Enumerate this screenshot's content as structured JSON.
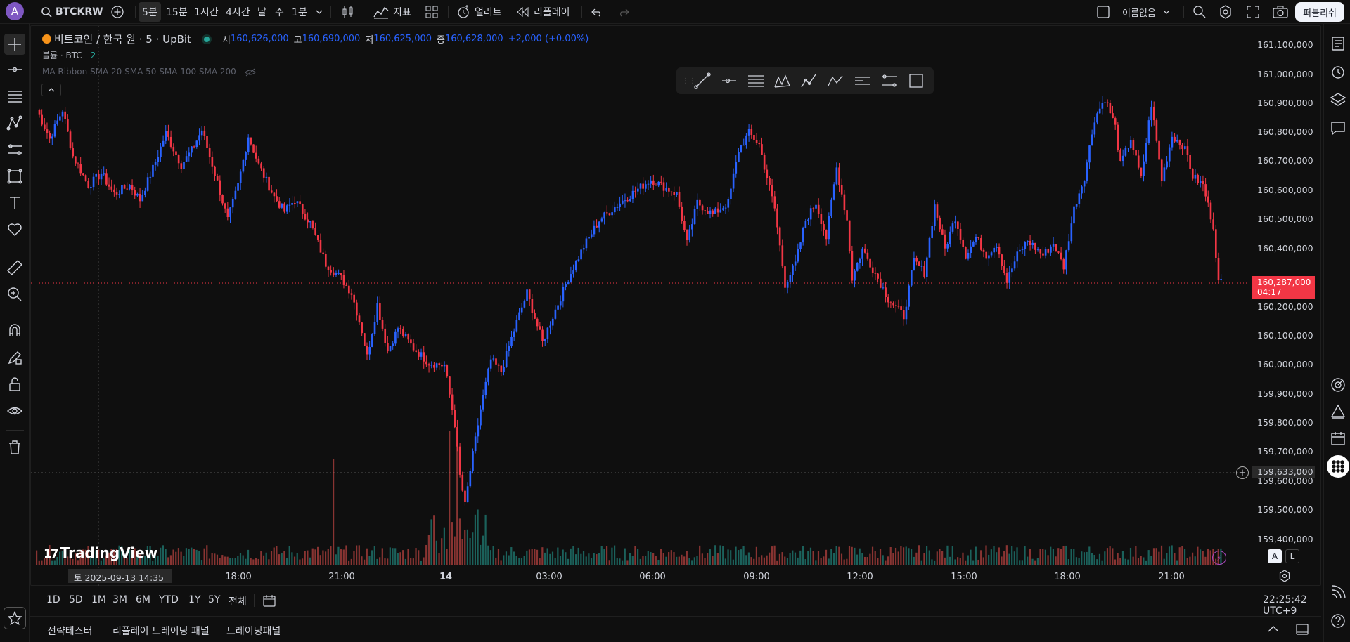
{
  "topbar": {
    "avatar_letter": "A",
    "symbol": "BTCKRW",
    "intervals": [
      "5분",
      "15분",
      "1시간",
      "4시간",
      "날",
      "주",
      "1분"
    ],
    "indicators_label": "지표",
    "alert_label": "얼러트",
    "replay_label": "리플레이",
    "layout_name": "이름없음",
    "publish_label": "퍼블리쉬"
  },
  "legend": {
    "title": "비트코인 / 한국 원 · 5 · UpBit",
    "open_label": "시",
    "open": "160,626,000",
    "high_label": "고",
    "high": "160,690,000",
    "low_label": "저",
    "low": "160,625,000",
    "close_label": "종",
    "close": "160,628,000",
    "change": "+2,000 (+0.00%)",
    "volume_label": "볼륨 · BTC",
    "volume_value": "2",
    "ma_ribbon": "MA Ribbon SMA 20 SMA 50 SMA 100 SMA 200"
  },
  "price_axis": {
    "labels": [
      "161,100,000",
      "161,000,000",
      "160,900,000",
      "160,800,000",
      "160,700,000",
      "160,600,000",
      "160,500,000",
      "160,400,000",
      "160,200,000",
      "160,100,000",
      "160,000,000",
      "159,900,000",
      "159,800,000",
      "159,700,000",
      "159,600,000",
      "159,500,000",
      "159,400,000"
    ],
    "current_price": "160,287,000",
    "countdown": "04:17",
    "crosshair_price": "159,633,000"
  },
  "time_axis": {
    "labels": [
      "18:00",
      "21:00",
      "14",
      "03:00",
      "06:00",
      "09:00",
      "12:00",
      "15:00",
      "18:00",
      "21:00"
    ],
    "crosshair_time": "토 2025-09-13   14:35"
  },
  "watermark": "TradingView",
  "scale_buttons": {
    "auto": "A",
    "log": "L"
  },
  "range_bar": {
    "ranges": [
      "1D",
      "5D",
      "1M",
      "3M",
      "6M",
      "YTD",
      "1Y",
      "5Y",
      "전체"
    ],
    "clock": "22:25:42 UTC+9"
  },
  "bottom_tabs": [
    "전략테스터",
    "리플레이 트레이딩 패널",
    "트레이딩패널"
  ],
  "colors": {
    "up": "#2962ff",
    "down": "#f23645",
    "vol_up": "#26a69a",
    "vol_down": "#ef5350",
    "bg": "#0f0f0f"
  },
  "chart_data": {
    "type": "candlestick",
    "symbol": "BTCKRW",
    "interval": "5",
    "ylim": [
      159350000,
      161150000
    ],
    "close_path": [
      [
        0,
        160880000
      ],
      [
        5,
        160780000
      ],
      [
        10,
        160880000
      ],
      [
        14,
        160720000
      ],
      [
        20,
        160620000
      ],
      [
        25,
        160660000
      ],
      [
        30,
        160590000
      ],
      [
        36,
        160620000
      ],
      [
        40,
        160570000
      ],
      [
        46,
        160700000
      ],
      [
        50,
        160800000
      ],
      [
        56,
        160690000
      ],
      [
        60,
        160740000
      ],
      [
        64,
        160810000
      ],
      [
        70,
        160630000
      ],
      [
        74,
        160500000
      ],
      [
        78,
        160620000
      ],
      [
        82,
        160790000
      ],
      [
        86,
        160690000
      ],
      [
        92,
        160580000
      ],
      [
        96,
        160530000
      ],
      [
        100,
        160570000
      ],
      [
        106,
        160490000
      ],
      [
        112,
        160350000
      ],
      [
        118,
        160300000
      ],
      [
        122,
        160250000
      ],
      [
        126,
        160120000
      ],
      [
        128,
        160030000
      ],
      [
        132,
        160210000
      ],
      [
        136,
        160050000
      ],
      [
        140,
        160130000
      ],
      [
        146,
        160060000
      ],
      [
        152,
        160010000
      ],
      [
        158,
        160000000
      ],
      [
        162,
        159800000
      ],
      [
        164,
        159620000
      ],
      [
        166,
        159520000
      ],
      [
        168,
        159640000
      ],
      [
        172,
        159850000
      ],
      [
        176,
        160020000
      ],
      [
        180,
        159980000
      ],
      [
        186,
        160150000
      ],
      [
        190,
        160250000
      ],
      [
        196,
        160080000
      ],
      [
        200,
        160170000
      ],
      [
        206,
        160300000
      ],
      [
        212,
        160410000
      ],
      [
        218,
        160500000
      ],
      [
        226,
        160560000
      ],
      [
        232,
        160600000
      ],
      [
        238,
        160640000
      ],
      [
        244,
        160610000
      ],
      [
        248,
        160590000
      ],
      [
        252,
        160420000
      ],
      [
        256,
        160560000
      ],
      [
        262,
        160520000
      ],
      [
        268,
        160560000
      ],
      [
        272,
        160740000
      ],
      [
        276,
        160800000
      ],
      [
        280,
        160760000
      ],
      [
        284,
        160610000
      ],
      [
        286,
        160540000
      ],
      [
        290,
        160280000
      ],
      [
        294,
        160350000
      ],
      [
        298,
        160500000
      ],
      [
        302,
        160560000
      ],
      [
        306,
        160440000
      ],
      [
        310,
        160680000
      ],
      [
        314,
        160500000
      ],
      [
        316,
        160300000
      ],
      [
        320,
        160400000
      ],
      [
        326,
        160300000
      ],
      [
        330,
        160230000
      ],
      [
        336,
        160170000
      ],
      [
        340,
        160360000
      ],
      [
        344,
        160320000
      ],
      [
        348,
        160550000
      ],
      [
        352,
        160400000
      ],
      [
        356,
        160510000
      ],
      [
        360,
        160380000
      ],
      [
        364,
        160440000
      ],
      [
        368,
        160380000
      ],
      [
        372,
        160420000
      ],
      [
        376,
        160290000
      ],
      [
        380,
        160380000
      ],
      [
        384,
        160430000
      ],
      [
        390,
        160380000
      ],
      [
        394,
        160420000
      ],
      [
        398,
        160340000
      ],
      [
        402,
        160540000
      ],
      [
        406,
        160650000
      ],
      [
        410,
        160850000
      ],
      [
        414,
        160920000
      ],
      [
        418,
        160820000
      ],
      [
        420,
        160690000
      ],
      [
        424,
        160780000
      ],
      [
        428,
        160640000
      ],
      [
        432,
        160900000
      ],
      [
        436,
        160640000
      ],
      [
        440,
        160790000
      ],
      [
        444,
        160760000
      ],
      [
        446,
        160720000
      ],
      [
        448,
        160650000
      ],
      [
        452,
        160620000
      ],
      [
        456,
        160480000
      ],
      [
        458,
        160287000
      ]
    ],
    "volume_note": "volume histogram per candle"
  }
}
